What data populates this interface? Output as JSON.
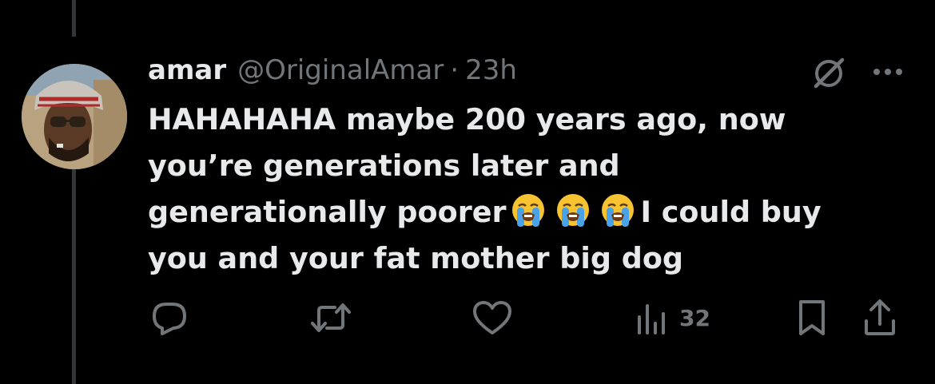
{
  "tweet": {
    "display_name": "amar",
    "handle": "@OriginalAmar",
    "separator": "·",
    "time": "23h",
    "text_line1": "HAHAHAHA maybe 200 years ago, now",
    "text_line2": "you’re generations later and",
    "text_line3a": "generationally poorer",
    "text_line3b": "I could buy",
    "text_line4": "you and your fat mother big dog",
    "emojis": [
      "loudly-crying-face",
      "loudly-crying-face",
      "loudly-crying-face"
    ]
  },
  "actions": {
    "reply": {
      "icon": "reply-icon"
    },
    "retweet": {
      "icon": "retweet-icon"
    },
    "like": {
      "icon": "heart-icon"
    },
    "views": {
      "icon": "views-icon",
      "count": "32"
    },
    "bookmark": {
      "icon": "bookmark-icon"
    },
    "share": {
      "icon": "share-icon"
    }
  },
  "colors": {
    "background": "#000000",
    "primary_text": "#e7e9ea",
    "secondary_text": "#71767b",
    "thread_line": "#333639"
  }
}
